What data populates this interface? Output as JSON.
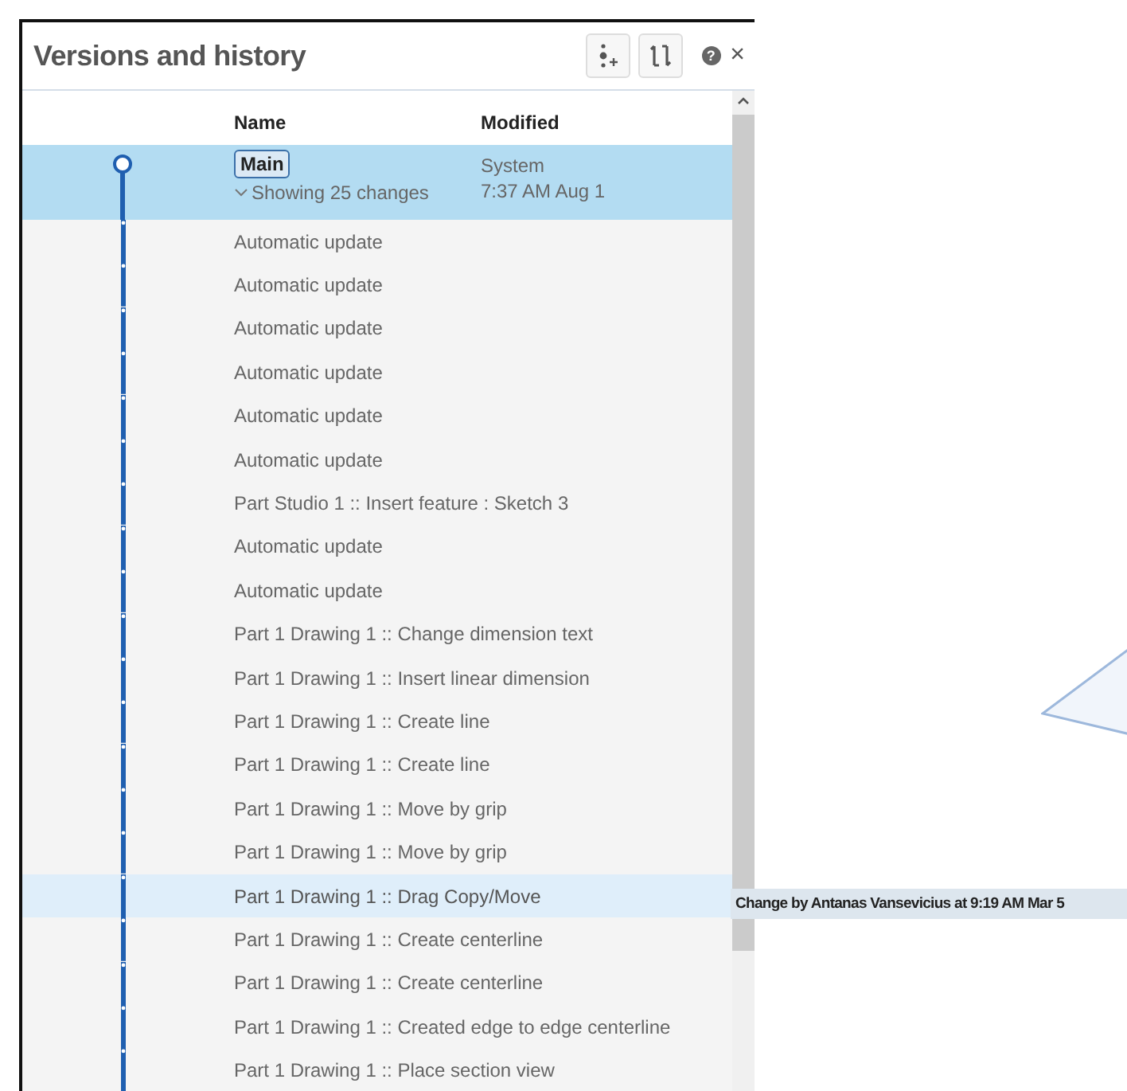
{
  "panel": {
    "title": "Versions and history",
    "help_glyph": "?",
    "close_glyph": "×"
  },
  "columns": [
    "Name",
    "Modified"
  ],
  "main": {
    "name": "Main",
    "changes": "Showing 25 changes",
    "modified_by": "System",
    "modified_at": "7:37 AM Aug 1",
    "selected": true
  },
  "rows": [
    {
      "name": "Automatic update",
      "hovered": false
    },
    {
      "name": "Automatic update",
      "hovered": false
    },
    {
      "name": "Automatic update",
      "hovered": false
    },
    {
      "name": "Automatic update",
      "hovered": false
    },
    {
      "name": "Automatic update",
      "hovered": false
    },
    {
      "name": "Automatic update",
      "hovered": false
    },
    {
      "name": "Part Studio 1 :: Insert feature : Sketch 3",
      "hovered": false
    },
    {
      "name": "Automatic update",
      "hovered": false
    },
    {
      "name": "Automatic update",
      "hovered": false
    },
    {
      "name": "Part 1 Drawing 1 :: Change dimension text",
      "hovered": false
    },
    {
      "name": "Part 1 Drawing 1 :: Insert linear dimension",
      "hovered": false
    },
    {
      "name": "Part 1 Drawing 1 :: Create line",
      "hovered": false
    },
    {
      "name": "Part 1 Drawing 1 :: Create line",
      "hovered": false
    },
    {
      "name": "Part 1 Drawing 1 :: Move by grip",
      "hovered": false
    },
    {
      "name": "Part 1 Drawing 1 :: Move by grip",
      "hovered": false
    },
    {
      "name": "Part 1 Drawing 1 :: Drag Copy/Move",
      "hovered": true
    },
    {
      "name": "Part 1 Drawing 1 :: Create centerline",
      "hovered": false
    },
    {
      "name": "Part 1 Drawing 1 :: Create centerline",
      "hovered": false
    },
    {
      "name": "Part 1 Drawing 1 :: Created edge to edge centerline",
      "hovered": false
    },
    {
      "name": "Part 1 Drawing 1 :: Place section view",
      "hovered": false
    }
  ],
  "tooltip": "Change by Antanas Vansevicius at 9:19 AM Mar 5"
}
